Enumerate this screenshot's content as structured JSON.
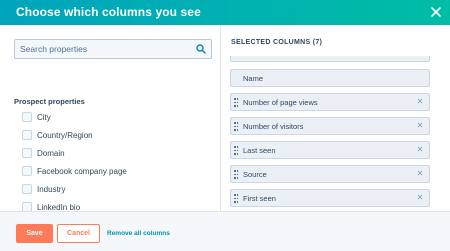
{
  "header": {
    "title": "Choose which columns you see",
    "background": "#00a4bd",
    "close_icon": "close-icon"
  },
  "search": {
    "placeholder": "Search properties",
    "value": "",
    "icon": "search-icon"
  },
  "property_group": {
    "title": "Prospect properties",
    "items": [
      {
        "label": "City",
        "checked": false
      },
      {
        "label": "Country/Region",
        "checked": false
      },
      {
        "label": "Domain",
        "checked": false
      },
      {
        "label": "Facebook company page",
        "checked": false
      },
      {
        "label": "Industry",
        "checked": false
      },
      {
        "label": "LinkedIn bio",
        "checked": false
      }
    ]
  },
  "selected": {
    "title": "SELECTED COLUMNS (7)",
    "columns": [
      {
        "label": "Name",
        "removable": false
      },
      {
        "label": "Number of page views",
        "removable": true
      },
      {
        "label": "Number of visitors",
        "removable": true
      },
      {
        "label": "Last seen",
        "removable": true
      },
      {
        "label": "Source",
        "removable": true
      },
      {
        "label": "First seen",
        "removable": true
      }
    ]
  },
  "footer": {
    "save_label": "Save",
    "cancel_label": "Cancel",
    "remove_all_label": "Remove all columns",
    "accent": "#ff7a59",
    "link_color": "#0091ae"
  }
}
